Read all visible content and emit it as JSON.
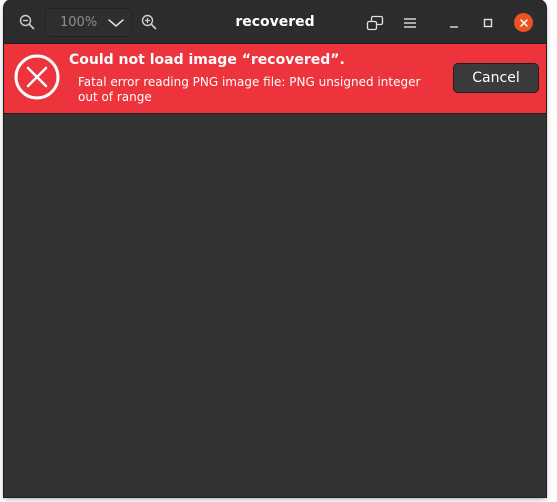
{
  "window": {
    "title": "recovered"
  },
  "header": {
    "zoom_value": "100%",
    "icons": {
      "zoom_out": "zoom-out-icon",
      "zoom_in": "zoom-in-icon",
      "zoom_dropdown": "chevron-down-icon",
      "fit": "fit-to-window-icon",
      "menu": "hamburger-menu-icon",
      "minimize": "minimize-icon",
      "maximize": "maximize-icon",
      "close": "close-icon"
    }
  },
  "infobar": {
    "title": "Could not load image “recovered”.",
    "message": "Fatal error reading PNG image file: PNG unsigned integer out of range",
    "cancel_label": "Cancel",
    "icon": "error-icon"
  },
  "colors": {
    "headerbar": "#2c2c2c",
    "content": "#333333",
    "error_bar": "#ed333b",
    "close_button": "#e95420",
    "cancel_button": "#3b3b3b"
  }
}
